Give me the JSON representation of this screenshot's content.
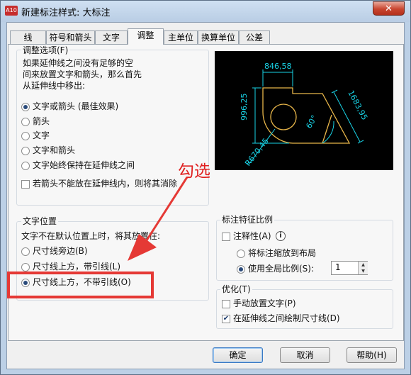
{
  "window": {
    "title": "新建标注样式: 大标注",
    "app_icon": "A10",
    "close_glyph": "✕"
  },
  "tabs": [
    {
      "label": "线"
    },
    {
      "label": "符号和箭头"
    },
    {
      "label": "文字"
    },
    {
      "label": "调整",
      "active": true
    },
    {
      "label": "主单位"
    },
    {
      "label": "换算单位"
    },
    {
      "label": "公差"
    }
  ],
  "fit_options": {
    "label": "调整选项(F)",
    "description": [
      "如果延伸线之间没有足够的空",
      "间来放置文字和箭头，那么首先",
      "从延伸线中移出:"
    ],
    "radios": [
      {
        "label": "文字或箭头 (最佳效果)",
        "selected": true
      },
      {
        "label": "箭头",
        "selected": false
      },
      {
        "label": "文字",
        "selected": false
      },
      {
        "label": "文字和箭头",
        "selected": false
      },
      {
        "label": "文字始终保持在延伸线之间",
        "selected": false
      }
    ],
    "suppress_checkbox": {
      "label": "若箭头不能放在延伸线内，则将其消除",
      "checked": false
    }
  },
  "preview": {
    "dim_horizontal": "846,58",
    "dim_vertical": "996,25",
    "dim_aligned": "1683,95",
    "dim_angle": "60°",
    "dim_radius": "R670,45",
    "colors": {
      "dimension": "#19d3e6",
      "geometry": "#e8b64a",
      "background": "#000000"
    }
  },
  "text_placement": {
    "label": "文字位置",
    "description": "文字不在默认位置上时，将其放置在:",
    "radios": [
      {
        "label": "尺寸线旁边(B)",
        "selected": false
      },
      {
        "label": "尺寸线上方，带引线(L)",
        "selected": false
      },
      {
        "label": "尺寸线上方，不带引线(O)",
        "selected": true
      }
    ]
  },
  "scale_features": {
    "label": "标注特征比例",
    "annotative": {
      "label": "注释性(A)",
      "checked": false
    },
    "info_glyph": "i",
    "radios": [
      {
        "label": "将标注缩放到布局",
        "selected": false
      },
      {
        "label": "使用全局比例(S):",
        "selected": true
      }
    ],
    "global_scale_value": "1"
  },
  "fine_tuning": {
    "label": "优化(T)",
    "checkboxes": [
      {
        "label": "手动放置文字(P)",
        "checked": false
      },
      {
        "label": "在延伸线之间绘制尺寸线(D)",
        "checked": true
      }
    ]
  },
  "buttons": {
    "ok": "确定",
    "cancel": "取消",
    "help": "帮助(H)"
  },
  "annotation": {
    "text": "勾选",
    "color": "#e53935"
  }
}
